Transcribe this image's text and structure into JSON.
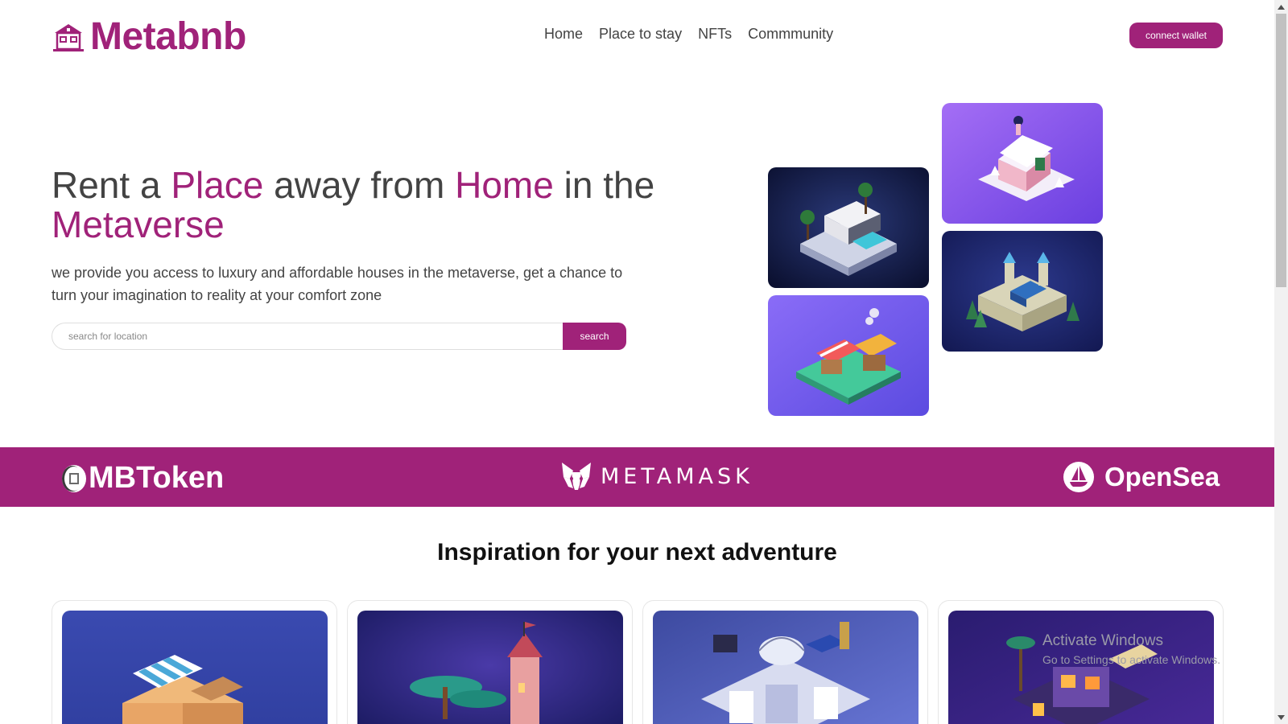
{
  "header": {
    "logo_text": "Metabnb",
    "nav": [
      "Home",
      "Place to stay",
      "NFTs",
      "Commmunity"
    ],
    "connect_label": "connect wallet"
  },
  "hero": {
    "title_parts": [
      "Rent a ",
      "Place",
      " away from ",
      "Home",
      " in the ",
      "Metaverse"
    ],
    "description": "we provide you access to luxury and affordable houses in the metaverse, get a chance to turn your imagination to reality at your comfort zone",
    "search_placeholder": "search for location",
    "search_label": "search"
  },
  "partners": {
    "mbtoken": "MBToken",
    "metamask": "METAMASK",
    "opensea": "OpenSea"
  },
  "inspiration": {
    "title": "Inspiration for your next adventure"
  },
  "watermark": {
    "title": "Activate Windows",
    "subtitle": "Go to Settings to activate Windows."
  },
  "colors": {
    "brand": "#A02279",
    "text": "#434343"
  },
  "icons": [
    "home-logo-icon",
    "mbtoken-coin-icon",
    "metamask-fox-icon",
    "opensea-boat-icon",
    "scroll-up-icon",
    "scroll-down-icon"
  ]
}
